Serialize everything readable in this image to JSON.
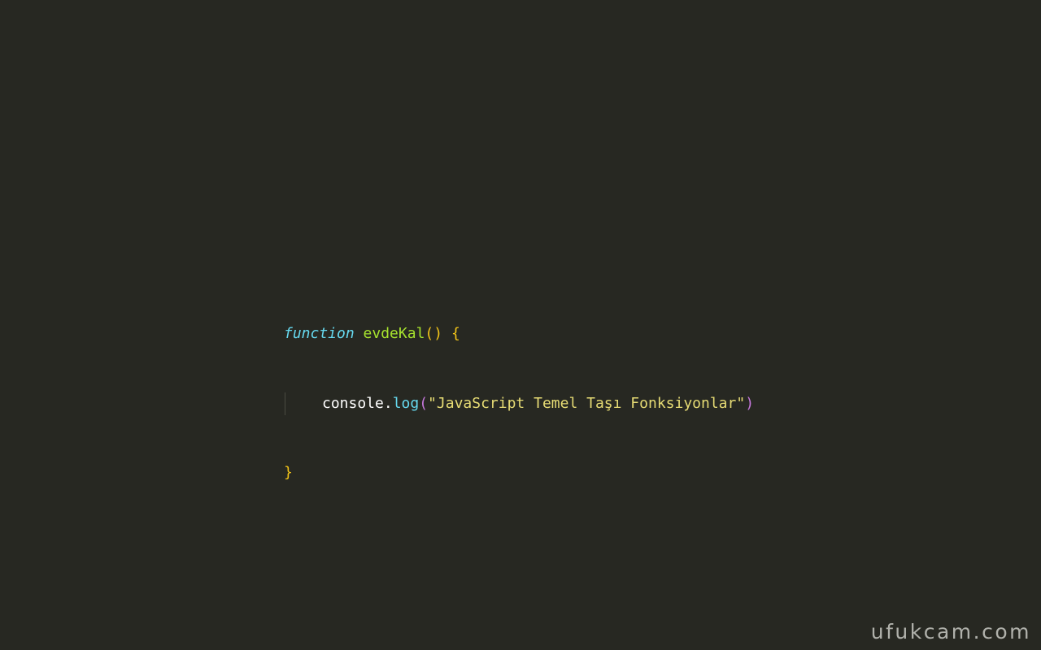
{
  "code": {
    "line1": {
      "keyword": "function",
      "space1": " ",
      "fn_name": "evdeKal",
      "parens": "()",
      "space2": " ",
      "open_brace": "{"
    },
    "line2": {
      "object": "console.",
      "method": "log",
      "open_paren": "(",
      "string": "\"JavaScript Temel Taşı Fonksiyonlar\"",
      "close_paren": ")"
    },
    "line3": {
      "close_brace": "}"
    }
  },
  "watermark": {
    "text": "ufukcam.com"
  },
  "colors": {
    "background": "#272822",
    "keyword": "#66d9ef",
    "function_name": "#a6e22e",
    "brace": "#f2c418",
    "string": "#e6db74",
    "paren_inner": "#c678dd",
    "plain": "#ffffff"
  }
}
